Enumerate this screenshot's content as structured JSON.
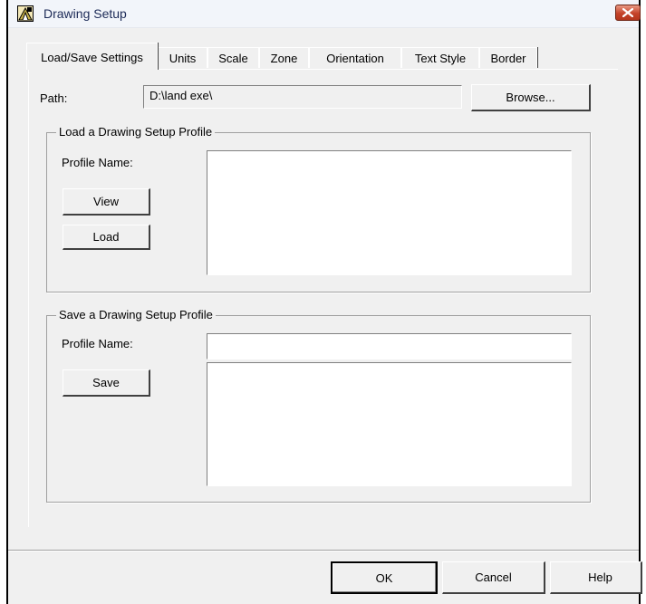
{
  "window": {
    "title": "Drawing Setup"
  },
  "tabs": [
    {
      "label": "Load/Save Settings",
      "active": true
    },
    {
      "label": "Units"
    },
    {
      "label": "Scale"
    },
    {
      "label": "Zone"
    },
    {
      "label": "Orientation"
    },
    {
      "label": "Text Style"
    },
    {
      "label": "Border"
    }
  ],
  "path": {
    "label": "Path:",
    "value": "D:\\land exe\\",
    "browse_label": "Browse..."
  },
  "load_group": {
    "legend": "Load a Drawing Setup Profile",
    "profile_label": "Profile Name:",
    "view_label": "View",
    "load_label": "Load"
  },
  "save_group": {
    "legend": "Save a Drawing Setup Profile",
    "profile_label": "Profile Name:",
    "profile_value": "",
    "save_label": "Save"
  },
  "footer": {
    "ok_label": "OK",
    "cancel_label": "Cancel",
    "help_label": "Help"
  },
  "colors": {
    "title_text": "#1c2a57",
    "close_button": "#c5432a",
    "dialog_bg": "#f0f0f0"
  },
  "icons": {
    "app": "drawing-setup-app-icon",
    "close": "close-icon"
  }
}
